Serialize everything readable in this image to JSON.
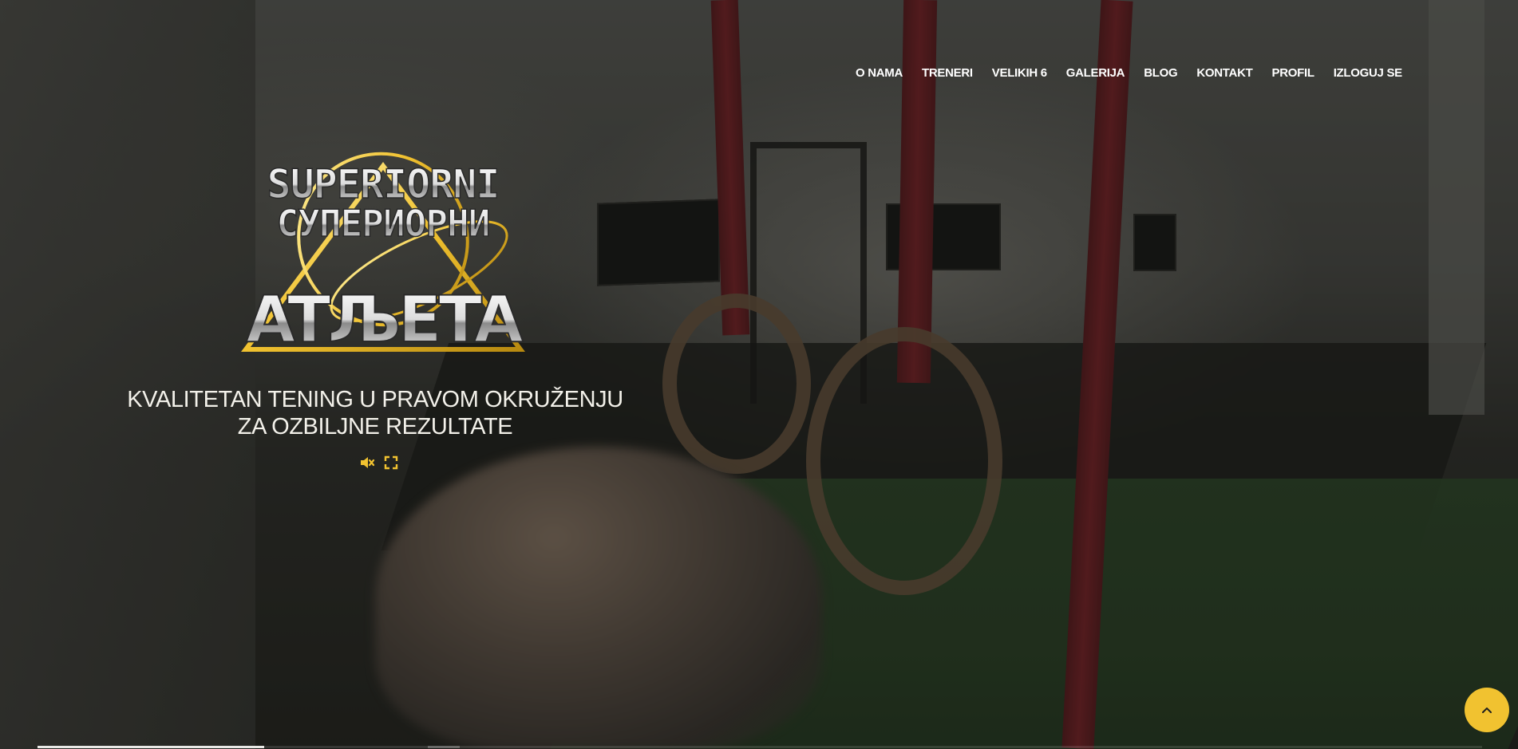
{
  "nav": {
    "items": [
      {
        "label": "O NAMA"
      },
      {
        "label": "TRENERI"
      },
      {
        "label": "VELIKIH 6"
      },
      {
        "label": "GALERIJA"
      },
      {
        "label": "BLOG"
      },
      {
        "label": "KONTAKT"
      },
      {
        "label": "PROFIL"
      },
      {
        "label": "IZLOGUJ SE"
      }
    ]
  },
  "logo": {
    "line1": "SUPERIORNI",
    "line2": "СУПЕРИОРНИ",
    "line3": "ATЉETA"
  },
  "hero": {
    "tagline_line1": "KVALITETAN TENING U PRAVOM OKRUŽENJU",
    "tagline_line2": "ZA OZBILJNE REZULTATE"
  },
  "video_controls": {
    "mute_icon": "speaker-muted-icon",
    "fullscreen_icon": "fullscreen-icon",
    "progress_played": 0.157,
    "progress_buffered_start": 0.27,
    "progress_buffered_end": 0.292
  },
  "back_to_top": {
    "icon": "chevron-up-icon"
  },
  "colors": {
    "accent": "#f1c230",
    "nav_text": "#ffffff",
    "tagline_text": "#f3f1ea"
  }
}
